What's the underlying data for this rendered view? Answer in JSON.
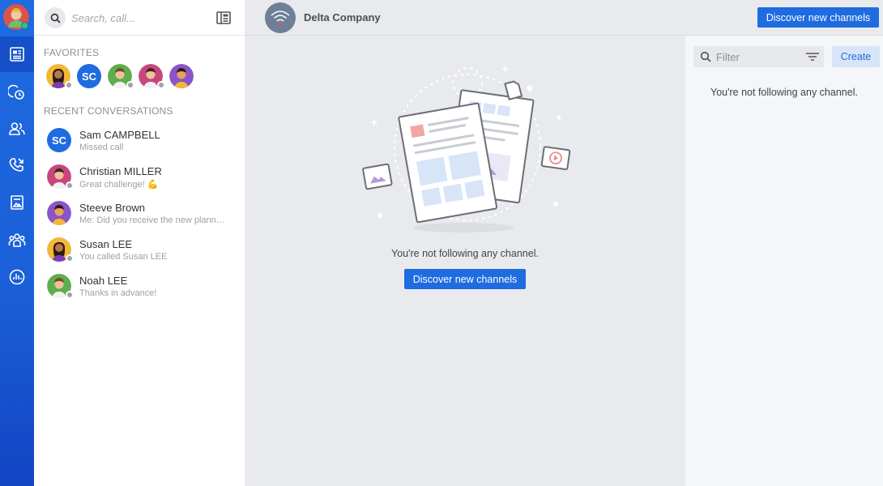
{
  "search": {
    "placeholder": "Search, call..."
  },
  "favorites": {
    "title": "FAVORITES",
    "people": [
      {
        "initials": "",
        "color": "#f2b838"
      },
      {
        "initials": "SC",
        "color": "#1f6be0"
      },
      {
        "initials": "",
        "color": "#5fae4e"
      },
      {
        "initials": "",
        "color": "#c8467e"
      },
      {
        "initials": "",
        "color": "#8a55c9"
      }
    ]
  },
  "recent": {
    "title": "RECENT CONVERSATIONS",
    "items": [
      {
        "name": "Sam CAMPBELL",
        "subtitle": "Missed call",
        "initials": "SC"
      },
      {
        "name": "Christian MILLER",
        "subtitle": "Great challenge! 💪"
      },
      {
        "name": "Steeve Brown",
        "subtitle": "Me: Did you receive the new planning?"
      },
      {
        "name": "Susan LEE",
        "subtitle": "You called Susan LEE"
      },
      {
        "name": "Noah LEE",
        "subtitle": "Thanks in advance!"
      }
    ]
  },
  "header": {
    "company": "Delta Company",
    "discover_label": "Discover new channels"
  },
  "main": {
    "empty_message": "You're not following any channel.",
    "discover_label": "Discover new channels"
  },
  "right_panel": {
    "filter_placeholder": "Filter",
    "create_label": "Create",
    "empty_message": "You're not following any channel."
  },
  "colors": {
    "accent": "#1f6be0",
    "rail": "#1a5fd8",
    "online": "#35c75a"
  }
}
